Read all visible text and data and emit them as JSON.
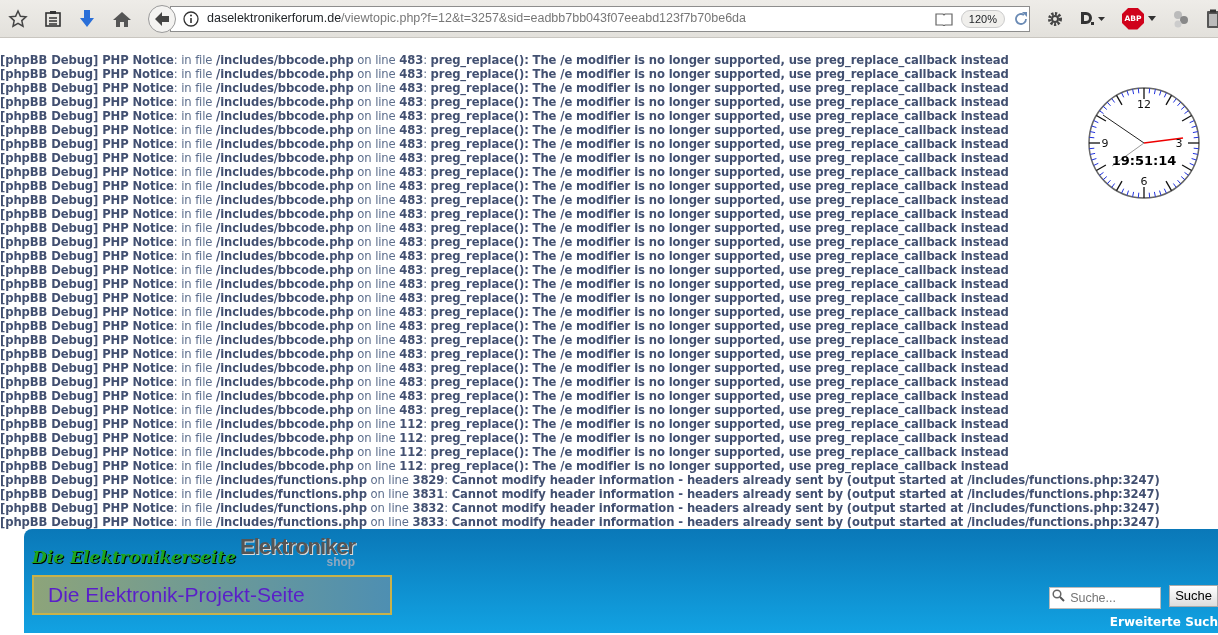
{
  "browser": {
    "url_host": "daselektronikerforum.de",
    "url_path": "/viewtopic.php?f=12&t=3257&sid=eadbb7bb043f07eeabd123f7b70be6da",
    "zoom": "120%",
    "adblock_label": "ABP"
  },
  "notices": [
    "**[phpBB Debug] PHP Notice**: in file **/includes/bbcode.php** on line **483**: **preg_replace(): The /e modifier is no longer supported, use preg_replace_callback instead**",
    "**[phpBB Debug] PHP Notice**: in file **/includes/bbcode.php** on line **483**: **preg_replace(): The /e modifier is no longer supported, use preg_replace_callback instead**",
    "**[phpBB Debug] PHP Notice**: in file **/includes/bbcode.php** on line **483**: **preg_replace(): The /e modifier is no longer supported, use preg_replace_callback instead**",
    "**[phpBB Debug] PHP Notice**: in file **/includes/bbcode.php** on line **483**: **preg_replace(): The /e modifier is no longer supported, use preg_replace_callback instead**",
    "**[phpBB Debug] PHP Notice**: in file **/includes/bbcode.php** on line **483**: **preg_replace(): The /e modifier is no longer supported, use preg_replace_callback instead**",
    "**[phpBB Debug] PHP Notice**: in file **/includes/bbcode.php** on line **483**: **preg_replace(): The /e modifier is no longer supported, use preg_replace_callback instead**",
    "**[phpBB Debug] PHP Notice**: in file **/includes/bbcode.php** on line **483**: **preg_replace(): The /e modifier is no longer supported, use preg_replace_callback instead**",
    "**[phpBB Debug] PHP Notice**: in file **/includes/bbcode.php** on line **483**: **preg_replace(): The /e modifier is no longer supported, use preg_replace_callback instead**",
    "**[phpBB Debug] PHP Notice**: in file **/includes/bbcode.php** on line **483**: **preg_replace(): The /e modifier is no longer supported, use preg_replace_callback instead**",
    "**[phpBB Debug] PHP Notice**: in file **/includes/bbcode.php** on line **483**: **preg_replace(): The /e modifier is no longer supported, use preg_replace_callback instead**",
    "**[phpBB Debug] PHP Notice**: in file **/includes/bbcode.php** on line **483**: **preg_replace(): The /e modifier is no longer supported, use preg_replace_callback instead**",
    "**[phpBB Debug] PHP Notice**: in file **/includes/bbcode.php** on line **483**: **preg_replace(): The /e modifier is no longer supported, use preg_replace_callback instead**",
    "**[phpBB Debug] PHP Notice**: in file **/includes/bbcode.php** on line **483**: **preg_replace(): The /e modifier is no longer supported, use preg_replace_callback instead**",
    "**[phpBB Debug] PHP Notice**: in file **/includes/bbcode.php** on line **483**: **preg_replace(): The /e modifier is no longer supported, use preg_replace_callback instead**",
    "**[phpBB Debug] PHP Notice**: in file **/includes/bbcode.php** on line **483**: **preg_replace(): The /e modifier is no longer supported, use preg_replace_callback instead**",
    "**[phpBB Debug] PHP Notice**: in file **/includes/bbcode.php** on line **483**: **preg_replace(): The /e modifier is no longer supported, use preg_replace_callback instead**",
    "**[phpBB Debug] PHP Notice**: in file **/includes/bbcode.php** on line **483**: **preg_replace(): The /e modifier is no longer supported, use preg_replace_callback instead**",
    "**[phpBB Debug] PHP Notice**: in file **/includes/bbcode.php** on line **483**: **preg_replace(): The /e modifier is no longer supported, use preg_replace_callback instead**",
    "**[phpBB Debug] PHP Notice**: in file **/includes/bbcode.php** on line **483**: **preg_replace(): The /e modifier is no longer supported, use preg_replace_callback instead**",
    "**[phpBB Debug] PHP Notice**: in file **/includes/bbcode.php** on line **483**: **preg_replace(): The /e modifier is no longer supported, use preg_replace_callback instead**",
    "**[phpBB Debug] PHP Notice**: in file **/includes/bbcode.php** on line **483**: **preg_replace(): The /e modifier is no longer supported, use preg_replace_callback instead**",
    "**[phpBB Debug] PHP Notice**: in file **/includes/bbcode.php** on line **483**: **preg_replace(): The /e modifier is no longer supported, use preg_replace_callback instead**",
    "**[phpBB Debug] PHP Notice**: in file **/includes/bbcode.php** on line **483**: **preg_replace(): The /e modifier is no longer supported, use preg_replace_callback instead**",
    "**[phpBB Debug] PHP Notice**: in file **/includes/bbcode.php** on line **483**: **preg_replace(): The /e modifier is no longer supported, use preg_replace_callback instead**",
    "**[phpBB Debug] PHP Notice**: in file **/includes/bbcode.php** on line **483**: **preg_replace(): The /e modifier is no longer supported, use preg_replace_callback instead**",
    "**[phpBB Debug] PHP Notice**: in file **/includes/bbcode.php** on line **483**: **preg_replace(): The /e modifier is no longer supported, use preg_replace_callback instead**",
    "**[phpBB Debug] PHP Notice**: in file **/includes/bbcode.php** on line **112**: **preg_replace(): The /e modifier is no longer supported, use preg_replace_callback instead**",
    "**[phpBB Debug] PHP Notice**: in file **/includes/bbcode.php** on line **112**: **preg_replace(): The /e modifier is no longer supported, use preg_replace_callback instead**",
    "**[phpBB Debug] PHP Notice**: in file **/includes/bbcode.php** on line **112**: **preg_replace(): The /e modifier is no longer supported, use preg_replace_callback instead**",
    "**[phpBB Debug] PHP Notice**: in file **/includes/bbcode.php** on line **112**: **preg_replace(): The /e modifier is no longer supported, use preg_replace_callback instead**",
    "**[phpBB Debug] PHP Notice**: in file **/includes/functions.php** on line **3829**: **Cannot modify header information - headers already sent by (output started at /includes/functions.php:3247)**",
    "**[phpBB Debug] PHP Notice**: in file **/includes/functions.php** on line **3831**: **Cannot modify header information - headers already sent by (output started at /includes/functions.php:3247)**",
    "**[phpBB Debug] PHP Notice**: in file **/includes/functions.php** on line **3832**: **Cannot modify header information - headers already sent by (output started at /includes/functions.php:3247)**",
    "**[phpBB Debug] PHP Notice**: in file **/includes/functions.php** on line **3833**: **Cannot modify header information - headers already sent by (output started at /includes/functions.php:3247)**"
  ],
  "clock": {
    "numerals": [
      "12",
      "3",
      "6",
      "9"
    ],
    "time": "19:51:14"
  },
  "header": {
    "logo_top": "Die Elektronikerseite",
    "shop_logo": "Elektroniker",
    "shop_logo_sub": "shop",
    "logo_bottom": "Die Elektronik-Projekt-Seite",
    "search": {
      "placeholder": "Suche...",
      "button": "Suche"
    },
    "advanced_search": "Erweiterte Such"
  }
}
